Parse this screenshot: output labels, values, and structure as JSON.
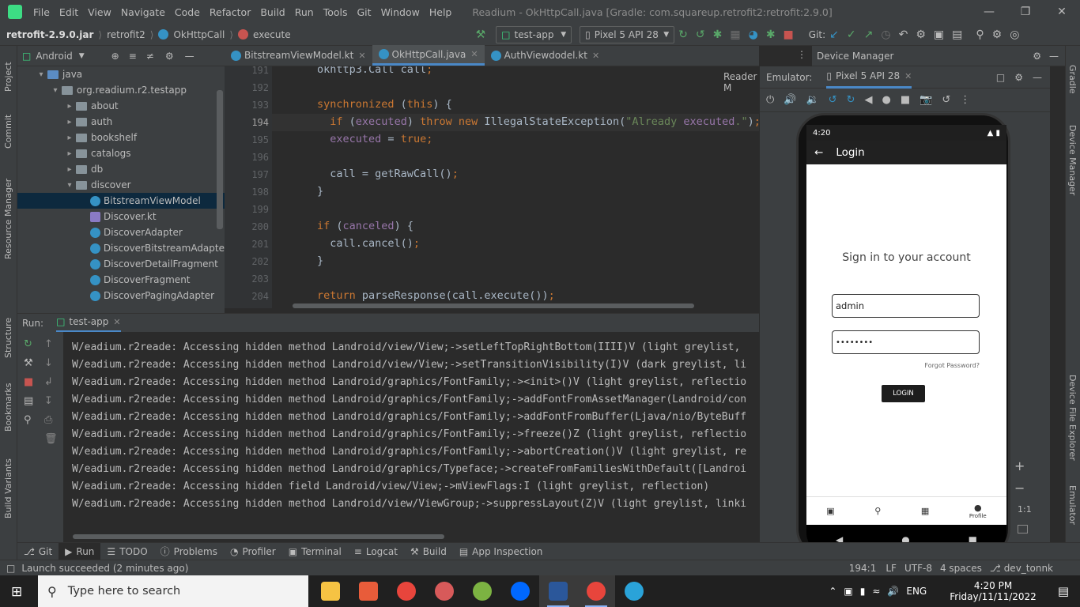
{
  "title_bar": {
    "menu": [
      "File",
      "Edit",
      "View",
      "Navigate",
      "Code",
      "Refactor",
      "Build",
      "Run",
      "Tools",
      "Git",
      "Window",
      "Help"
    ],
    "window_title": "Readium - OkHttpCall.java [Gradle: com.squareup.retrofit2:retrofit:2.9.0]"
  },
  "nav": {
    "crumbs": [
      "retrofit-2.9.0.jar",
      "retrofit2",
      "OkHttpCall",
      "execute"
    ],
    "run_config": "test-app",
    "device": "Pixel 5 API 28",
    "git_label": "Git:"
  },
  "left_stripe": [
    "Project",
    "Commit",
    "Resource Manager",
    "Structure",
    "Bookmarks",
    "Build Variants"
  ],
  "right_stripe": [
    "Gradle",
    "Device Manager",
    "Device File Explorer",
    "Emulator"
  ],
  "project": {
    "view": "Android",
    "rows": [
      {
        "label": "java",
        "indent": 0,
        "kind": "folder-blue",
        "open": true
      },
      {
        "label": "org.readium.r2.testapp",
        "indent": 1,
        "kind": "folder",
        "open": true
      },
      {
        "label": "about",
        "indent": 2,
        "kind": "folder",
        "open": false
      },
      {
        "label": "auth",
        "indent": 2,
        "kind": "folder",
        "open": false
      },
      {
        "label": "bookshelf",
        "indent": 2,
        "kind": "folder",
        "open": false
      },
      {
        "label": "catalogs",
        "indent": 2,
        "kind": "folder",
        "open": false
      },
      {
        "label": "db",
        "indent": 2,
        "kind": "folder",
        "open": false
      },
      {
        "label": "discover",
        "indent": 2,
        "kind": "folder",
        "open": true
      },
      {
        "label": "BitstreamViewModel",
        "indent": 3,
        "kind": "class",
        "selected": true
      },
      {
        "label": "Discover.kt",
        "indent": 3,
        "kind": "file"
      },
      {
        "label": "DiscoverAdapter",
        "indent": 3,
        "kind": "class"
      },
      {
        "label": "DiscoverBitstreamAdapte",
        "indent": 3,
        "kind": "class"
      },
      {
        "label": "DiscoverDetailFragment",
        "indent": 3,
        "kind": "class"
      },
      {
        "label": "DiscoverFragment",
        "indent": 3,
        "kind": "class"
      },
      {
        "label": "DiscoverPagingAdapter",
        "indent": 3,
        "kind": "class"
      }
    ]
  },
  "editor": {
    "tabs": [
      {
        "label": "BitstreamViewModel.kt",
        "active": false
      },
      {
        "label": "OkHttpCall.java",
        "active": true
      },
      {
        "label": "AuthViewdodel.kt",
        "active": false
      }
    ],
    "reader_mode": "Reader M",
    "lines": [
      {
        "num": "191",
        "code": "okhttp3.Call call;"
      },
      {
        "num": "192",
        "code": ""
      },
      {
        "num": "193",
        "code": "synchronized (this) {"
      },
      {
        "num": "194",
        "code": "  if (executed) throw new IllegalStateException(\"Already executed.\");"
      },
      {
        "num": "195",
        "code": "  executed = true;"
      },
      {
        "num": "196",
        "code": ""
      },
      {
        "num": "197",
        "code": "  call = getRawCall();"
      },
      {
        "num": "198",
        "code": "}"
      },
      {
        "num": "199",
        "code": ""
      },
      {
        "num": "200",
        "code": "if (canceled) {"
      },
      {
        "num": "201",
        "code": "  call.cancel();"
      },
      {
        "num": "202",
        "code": "}"
      },
      {
        "num": "203",
        "code": ""
      },
      {
        "num": "204",
        "code": "return parseResponse(call.execute());"
      }
    ]
  },
  "device_manager": {
    "title": "Device Manager",
    "emulator_label": "Emulator:",
    "emulator_tab": "Pixel 5 API 28"
  },
  "phone": {
    "time": "4:20",
    "appbar_title": "Login",
    "heading": "Sign in to your account",
    "username": "admin",
    "password": "••••••••",
    "forgot": "Forgot Password?",
    "login_button": "LOGIN",
    "bottom_nav": [
      "",
      "",
      "",
      "Profile"
    ],
    "zoom": "1:1"
  },
  "run": {
    "label": "Run:",
    "config": "test-app",
    "lines": [
      "W/eadium.r2reade: Accessing hidden method Landroid/view/View;->setLeftTopRightBottom(IIII)V (light greylist,",
      "W/eadium.r2reade: Accessing hidden method Landroid/view/View;->setTransitionVisibility(I)V (dark greylist, li",
      "W/eadium.r2reade: Accessing hidden method Landroid/graphics/FontFamily;-><init>()V (light greylist, reflectio",
      "W/eadium.r2reade: Accessing hidden method Landroid/graphics/FontFamily;->addFontFromAssetManager(Landroid/con",
      "W/eadium.r2reade: Accessing hidden method Landroid/graphics/FontFamily;->addFontFromBuffer(Ljava/nio/ByteBuff",
      "W/eadium.r2reade: Accessing hidden method Landroid/graphics/FontFamily;->freeze()Z (light greylist, reflectio",
      "W/eadium.r2reade: Accessing hidden method Landroid/graphics/FontFamily;->abortCreation()V (light greylist, re",
      "W/eadium.r2reade: Accessing hidden method Landroid/graphics/Typeface;->createFromFamiliesWithDefault([Landroi",
      "W/eadium.r2reade: Accessing hidden field Landroid/view/View;->mViewFlags:I (light greylist, reflection)",
      "W/eadium.r2reade: Accessing hidden method Landroid/view/ViewGroup;->suppressLayout(Z)V (light greylist, linki"
    ]
  },
  "tool_tabs": [
    "Git",
    "Run",
    "TODO",
    "Problems",
    "Profiler",
    "Terminal",
    "Logcat",
    "Build",
    "App Inspection"
  ],
  "status": {
    "message": "Launch succeeded (2 minutes ago)",
    "position": "194:1",
    "line_sep": "LF",
    "encoding": "UTF-8",
    "indent": "4 spaces",
    "branch": "dev_tonnk"
  },
  "taskbar": {
    "search_placeholder": "Type here to search",
    "lang": "ENG",
    "time": "4:20 PM",
    "date": "Friday/11/11/2022"
  }
}
